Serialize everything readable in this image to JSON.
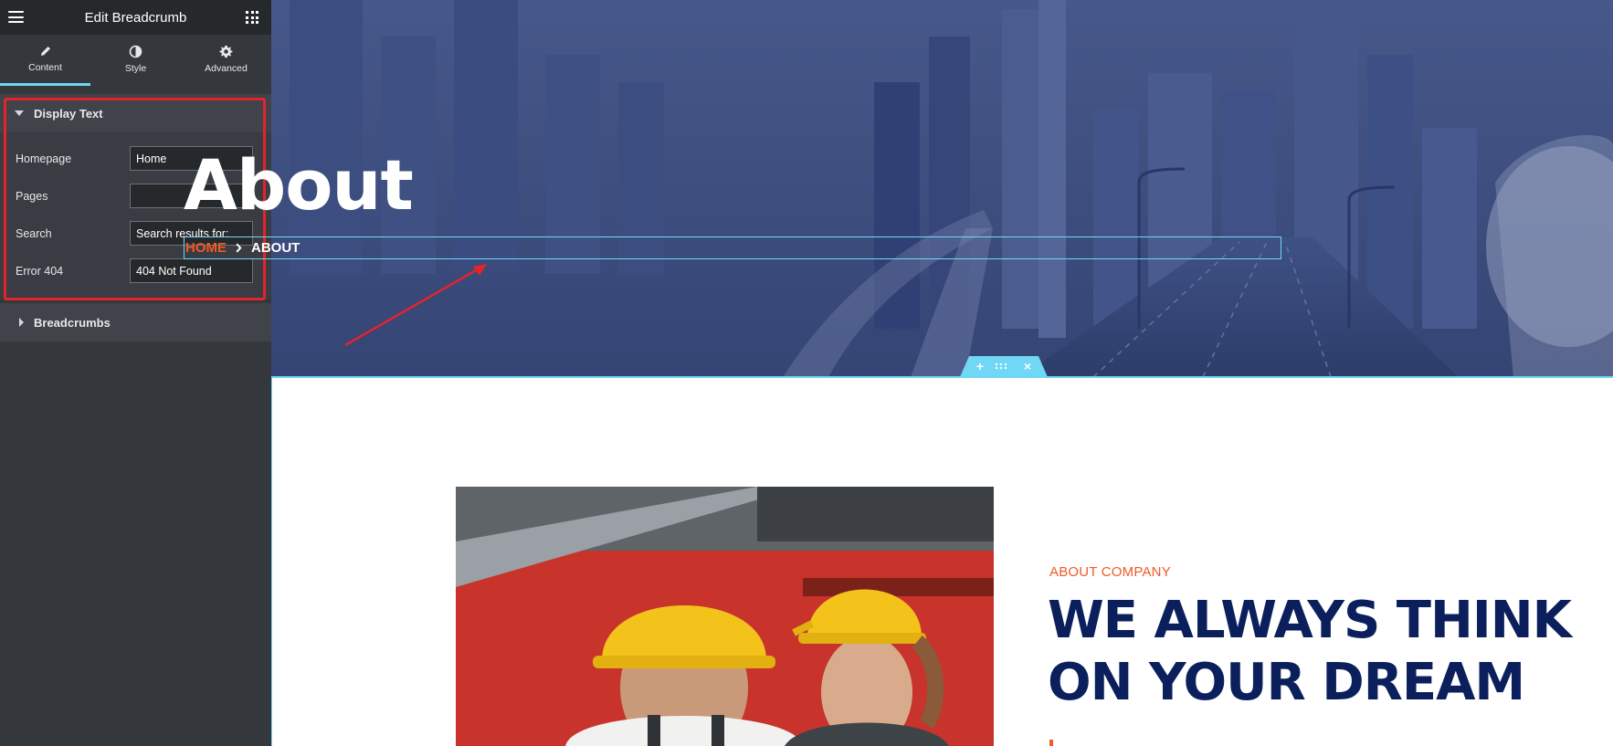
{
  "panel": {
    "title": "Edit Breadcrumb",
    "tabs": [
      {
        "label": "Content",
        "icon": "pencil-icon",
        "active": true
      },
      {
        "label": "Style",
        "icon": "half-circle-icon",
        "active": false
      },
      {
        "label": "Advanced",
        "icon": "gear-icon",
        "active": false
      }
    ],
    "display_text": {
      "title": "Display Text",
      "fields": [
        {
          "label": "Homepage",
          "value": "Home"
        },
        {
          "label": "Pages",
          "value": ""
        },
        {
          "label": "Search",
          "value": "Search results for:"
        },
        {
          "label": "Error 404",
          "value": "404 Not Found"
        }
      ]
    },
    "breadcrumbs_section": {
      "title": "Breadcrumbs"
    }
  },
  "hero": {
    "title": "About",
    "breadcrumb": {
      "home": "HOME",
      "current": "ABOUT"
    }
  },
  "section_handle": {
    "add": "+",
    "close": "×"
  },
  "about": {
    "tag": "ABOUT COMPANY",
    "heading_line1": "WE ALWAYS THINK",
    "heading_line2": "ON YOUR DREAM"
  },
  "colors": {
    "accent_orange": "#f15a24",
    "heading_navy": "#0b1f5c",
    "editor_selection": "#71d7f7",
    "annotation_red": "#e3242b"
  }
}
